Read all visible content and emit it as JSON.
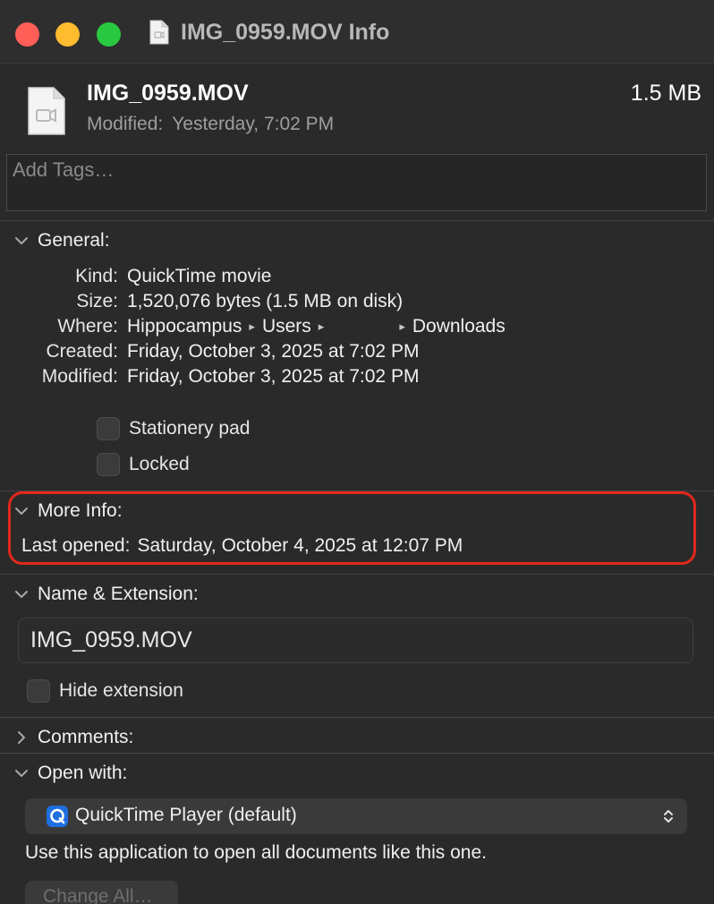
{
  "window": {
    "title": "IMG_0959.MOV Info"
  },
  "header": {
    "filename": "IMG_0959.MOV",
    "size": "1.5 MB",
    "modified_label": "Modified:",
    "modified_value": "Yesterday, 7:02 PM",
    "file_icon": "video-file-icon"
  },
  "tags": {
    "placeholder": "Add Tags…"
  },
  "general": {
    "header": "General:",
    "rows": [
      {
        "label": "Kind:",
        "value": "QuickTime movie"
      },
      {
        "label": "Size:",
        "value": "1,520,076 bytes (1.5 MB on disk)"
      },
      {
        "label": "Where:",
        "path": [
          "Hippocampus",
          "Users",
          "",
          "Downloads"
        ]
      },
      {
        "label": "Created:",
        "value": "Friday, October 3, 2025 at 7:02 PM"
      },
      {
        "label": "Modified:",
        "value": "Friday, October 3, 2025 at 7:02 PM"
      }
    ],
    "stationery_label": "Stationery pad",
    "locked_label": "Locked"
  },
  "more_info": {
    "header": "More Info:",
    "last_opened_label": "Last opened:",
    "last_opened_value": "Saturday, October 4, 2025 at 12:07 PM",
    "highlight_color": "#e2281c"
  },
  "name_ext": {
    "header": "Name & Extension:",
    "value": "IMG_0959.MOV",
    "hide_extension_label": "Hide extension"
  },
  "comments": {
    "header": "Comments:"
  },
  "open_with": {
    "header": "Open with:",
    "app": "QuickTime Player (default)",
    "app_icon": "quicktime-icon",
    "use_text": "Use this application to open all documents like this one.",
    "change_all_label": "Change All…"
  },
  "colors": {
    "close": "#ff5f57",
    "minimize": "#febc2e",
    "maximize": "#28c840",
    "background": "#2a2a2a"
  }
}
